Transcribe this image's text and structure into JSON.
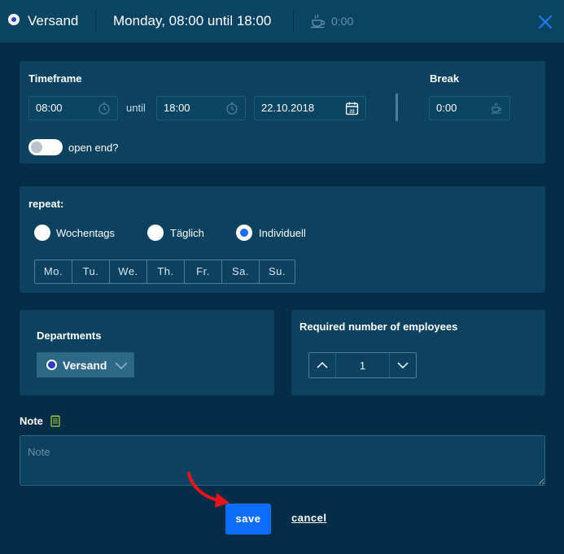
{
  "header": {
    "department": "Versand",
    "time_range": "Monday, 08:00 until 18:00",
    "break_value": "0:00",
    "icons": {
      "department_dot": "dot-icon",
      "break": "coffee-cup-icon",
      "close": "close-icon"
    },
    "accent": "#1a6ff0"
  },
  "timeframe": {
    "title": "Timeframe",
    "start": "08:00",
    "until_label": "until",
    "end": "18:00",
    "date": "22.10.2018",
    "calendar_day": "22",
    "break_title": "Break",
    "break": "0:00",
    "open_end_label": "open end?",
    "open_end_enabled": false
  },
  "repeat": {
    "title": "repeat:",
    "options": [
      {
        "label": "Wochentags",
        "selected": false
      },
      {
        "label": "Täglich",
        "selected": false
      },
      {
        "label": "Individuell",
        "selected": true
      }
    ],
    "days": [
      "Mo.",
      "Tu.",
      "We.",
      "Th.",
      "Fr.",
      "Sa.",
      "Su."
    ]
  },
  "departments": {
    "title": "Departments",
    "selected": "Versand"
  },
  "employees": {
    "title": "Required number of employees",
    "value": "1"
  },
  "note": {
    "label": "Note",
    "placeholder": "Note",
    "value": ""
  },
  "actions": {
    "save": "save",
    "cancel": "cancel"
  },
  "colors": {
    "background": "#062d47",
    "panel": "#0c4260",
    "primary_button": "#0d6efd",
    "annotation_arrow": "#e3171b"
  }
}
